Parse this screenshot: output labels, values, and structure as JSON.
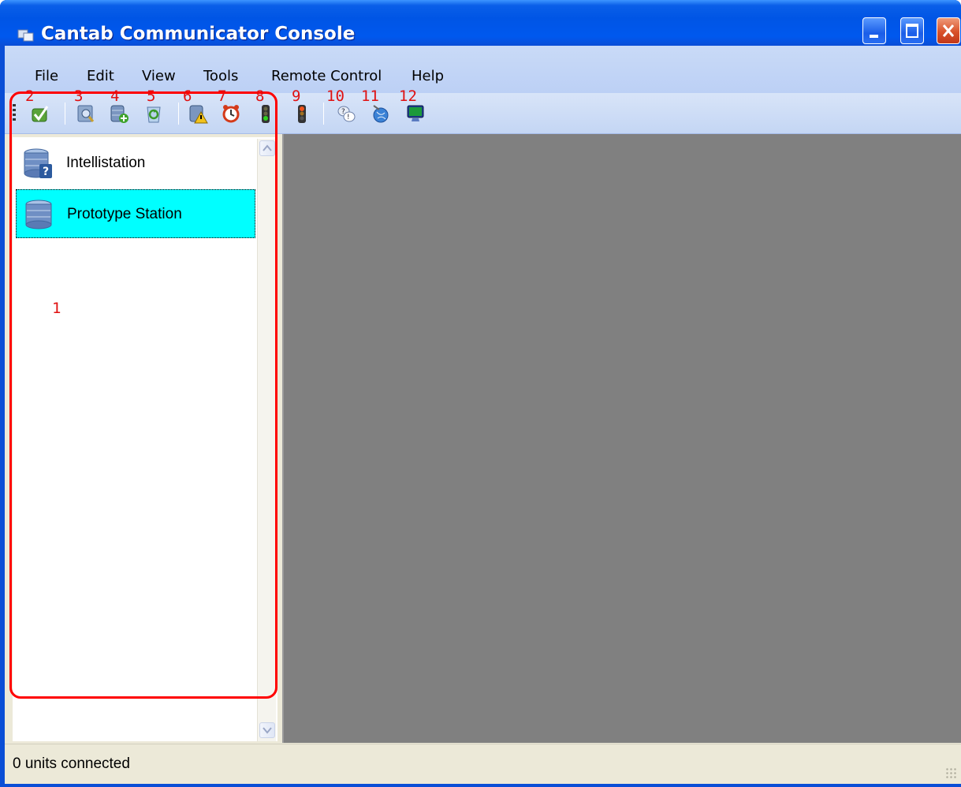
{
  "window": {
    "title": "Cantab Communicator Console"
  },
  "menu": [
    "File",
    "Edit",
    "View",
    "Tools",
    "Remote Control",
    "Help"
  ],
  "callouts": [
    "1",
    "2",
    "3",
    "4",
    "5",
    "6",
    "7",
    "8",
    "9",
    "10",
    "11",
    "12"
  ],
  "toolbar": {
    "tools": [
      {
        "icon": "checkmark-icon"
      },
      {
        "icon": "scan-icon"
      },
      {
        "icon": "add-station-icon"
      },
      {
        "icon": "recycle-icon"
      },
      {
        "icon": "warning-station-icon"
      },
      {
        "icon": "alarm-clock-icon"
      },
      {
        "icon": "traffic-light-green-icon"
      },
      {
        "icon": "traffic-light-red-icon"
      },
      {
        "icon": "help-chat-icon"
      },
      {
        "icon": "globe-satellite-icon"
      },
      {
        "icon": "monitor-icon"
      }
    ]
  },
  "stations": [
    {
      "label": "Intellistation",
      "icon": "unknown-station-icon",
      "selected": false
    },
    {
      "label": "Prototype Station",
      "icon": "station-icon",
      "selected": true
    }
  ],
  "status": {
    "text": "0 units connected"
  },
  "colors": {
    "selection": "#00ffff",
    "callout": "#ff0000",
    "workspace": "#808080"
  }
}
